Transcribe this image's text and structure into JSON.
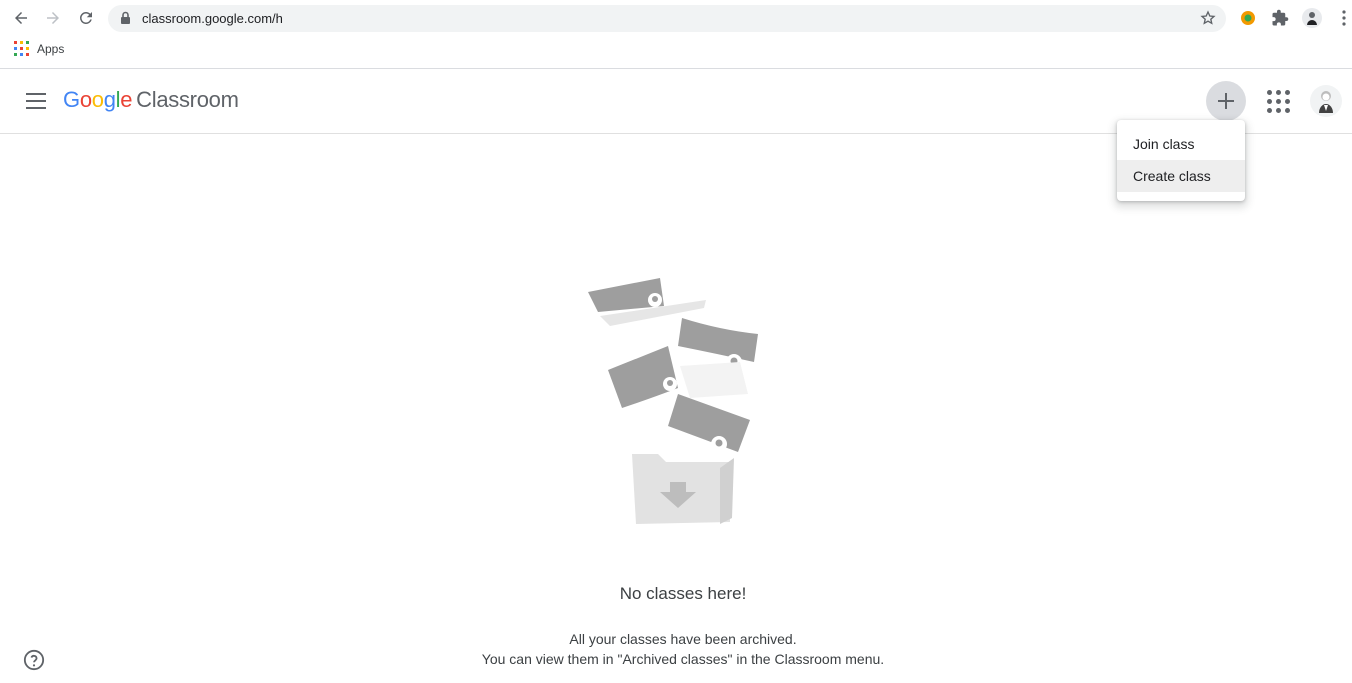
{
  "browser": {
    "url": "classroom.google.com/h",
    "bookmarks_apps_label": "Apps"
  },
  "appbar": {
    "logo_google": [
      "G",
      "o",
      "o",
      "g",
      "l",
      "e"
    ],
    "logo_product": "Classroom"
  },
  "menu": {
    "items": [
      {
        "label": "Join class"
      },
      {
        "label": "Create class"
      }
    ]
  },
  "empty_state": {
    "title": "No classes here!",
    "line1": "All your classes have been archived.",
    "line2": "You can view them in \"Archived classes\" in the Classroom menu."
  },
  "colors": {
    "google_blue": "#4285f4",
    "google_red": "#ea4335",
    "google_yellow": "#fbbc05",
    "google_green": "#34a853",
    "menu_active_bg": "#eeeeee"
  }
}
